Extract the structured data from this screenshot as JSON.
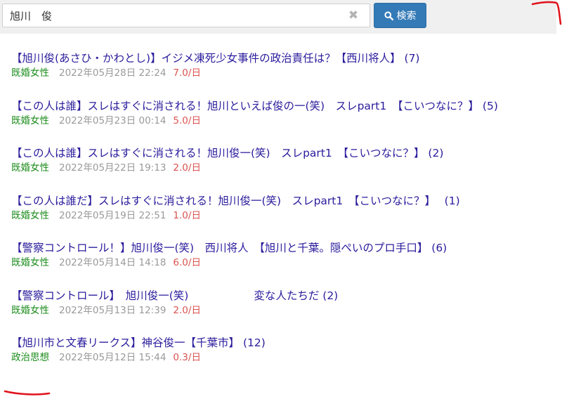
{
  "search": {
    "value": "旭川　俊",
    "clear_glyph": "✖",
    "button_label": "検索"
  },
  "results": [
    {
      "title": "【旭川俊(あさひ・かわとし)】イジメ凍死少女事件の政治責任は？【西川将人】 (7)",
      "category": "既婚女性",
      "date": "2022年05月28日 22:24",
      "rate": "7.0/日"
    },
    {
      "title": "【この人は誰】スレはすぐに消される！旭川といえば俊の一(笑)　スレpart1　【こいつなに？】 (5)",
      "category": "既婚女性",
      "date": "2022年05月23日 00:14",
      "rate": "5.0/日"
    },
    {
      "title": "【この人は誰】スレはすぐに消される！旭川俊一(笑)　スレpart1　【こいつなに？】 (2)",
      "category": "既婚女性",
      "date": "2022年05月22日 19:13",
      "rate": "2.0/日"
    },
    {
      "title": "【この人は誰だ】スレはすぐに消される！旭川俊一(笑)　スレpart1　【こいつなに？】　 (1)",
      "category": "既婚女性",
      "date": "2022年05月19日 22:51",
      "rate": "1.0/日"
    },
    {
      "title": "【警察コントロール！】旭川俊一(笑)　西川将人　【旭川と千葉。隠ぺいのプロ手口】 (6)",
      "category": "既婚女性",
      "date": "2022年05月14日 14:18",
      "rate": "6.0/日"
    },
    {
      "title": "【警察コントロール】　旭川俊一(笑)　　　　　　変な人たちだ (2)",
      "category": "既婚女性",
      "date": "2022年05月13日 12:39",
      "rate": "2.0/日"
    },
    {
      "title": "【旭川市と文春リークス】神谷俊一【千葉市】 (12)",
      "category": "政治思想",
      "date": "2022年05月12日 15:44",
      "rate": "0.3/日"
    }
  ],
  "colors": {
    "link": "#2a1c9c",
    "category": "#1c8c1c",
    "date": "#9a9a9a",
    "rate": "#d9534f",
    "button": "#337ab7",
    "annotation": "#e0101a"
  },
  "icons": {
    "search_button": "magnifier-icon",
    "clear": "close-icon"
  }
}
